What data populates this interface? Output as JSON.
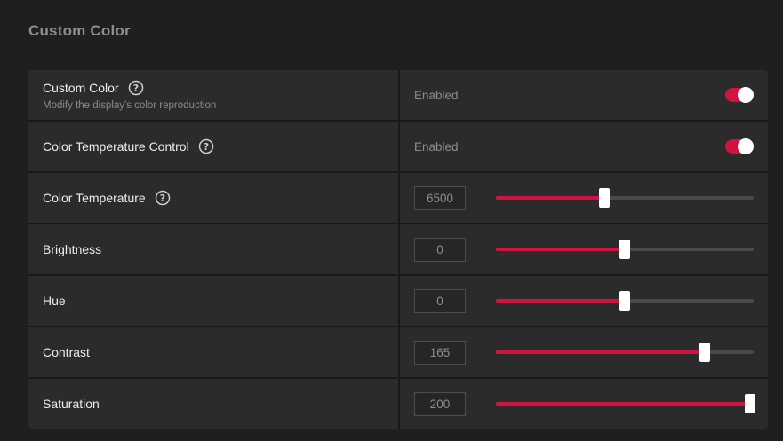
{
  "section": {
    "title": "Custom Color"
  },
  "rows": [
    {
      "label": "Custom Color",
      "subtext": "Modify the display's color reproduction",
      "has_help": true,
      "control": "toggle",
      "status": "Enabled",
      "toggle_on": true
    },
    {
      "label": "Color Temperature Control",
      "has_help": true,
      "control": "toggle",
      "status": "Enabled",
      "toggle_on": true
    },
    {
      "label": "Color Temperature",
      "has_help": true,
      "control": "slider",
      "value": "6500",
      "slider_fraction": 0.42
    },
    {
      "label": "Brightness",
      "has_help": false,
      "control": "slider",
      "value": "0",
      "slider_fraction": 0.5
    },
    {
      "label": "Hue",
      "has_help": false,
      "control": "slider",
      "value": "0",
      "slider_fraction": 0.5
    },
    {
      "label": "Contrast",
      "has_help": false,
      "control": "slider",
      "value": "165",
      "slider_fraction": 0.81
    },
    {
      "label": "Saturation",
      "has_help": false,
      "control": "slider",
      "value": "200",
      "slider_fraction": 1.0
    }
  ],
  "icons": {
    "help": "question-circle-icon"
  },
  "colors": {
    "accent": "#d1143f",
    "background": "#1f1f1f",
    "row_background": "#2b2b2b",
    "muted_text": "#8d8d8d"
  }
}
